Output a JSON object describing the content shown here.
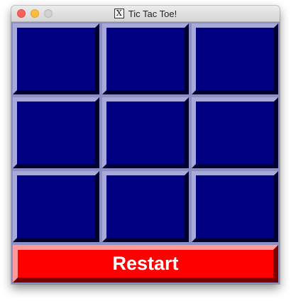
{
  "window": {
    "title": "Tic Tac Toe!",
    "app_icon": "x11-icon",
    "app_icon_glyph": "X"
  },
  "board": {
    "cells": [
      "",
      "",
      "",
      "",
      "",
      "",
      "",
      "",
      ""
    ],
    "cell_color": "#000080",
    "grid_color": "#8c8fc4"
  },
  "controls": {
    "restart_label": "Restart",
    "restart_color": "#ff0000"
  }
}
